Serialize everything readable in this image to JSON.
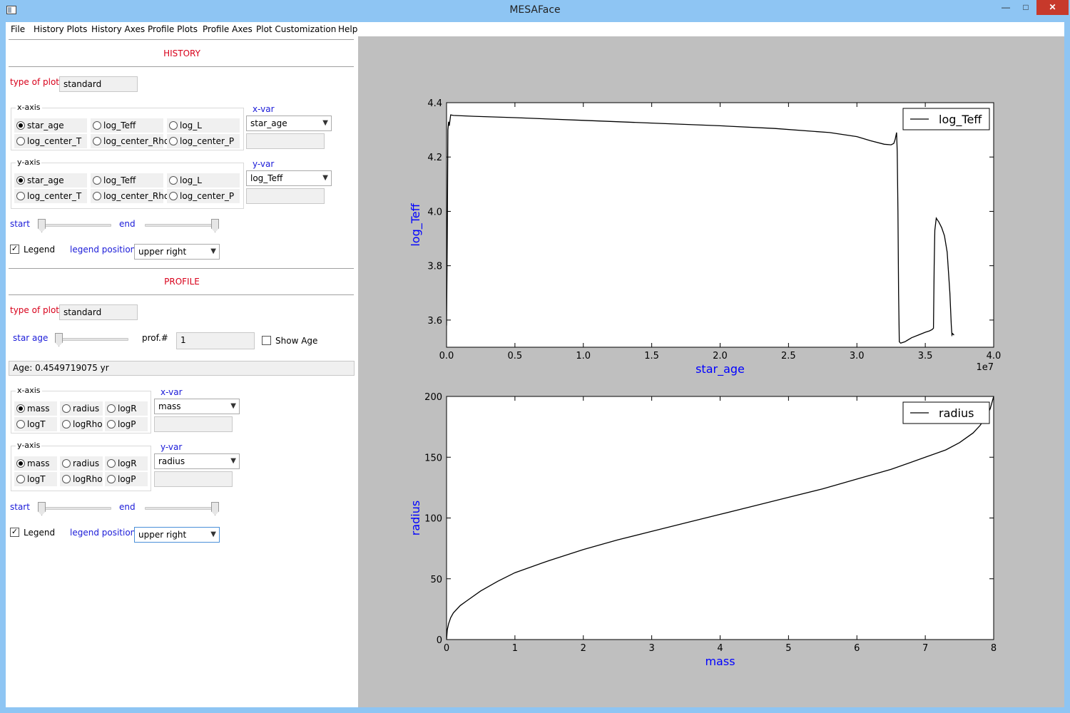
{
  "window": {
    "title": "MESAFace"
  },
  "menu": [
    "File",
    "History Plots",
    "History Axes",
    "Profile Plots",
    "Profile Axes",
    "Plot Customization",
    "Help"
  ],
  "history": {
    "section_title": "HISTORY",
    "type_of_plot_label": "type of plot:",
    "type_of_plot_value": "standard",
    "x_axis": {
      "group_title": "x-axis",
      "options": [
        "star_age",
        "log_Teff",
        "log_L",
        "log_center_T",
        "log_center_Rho",
        "log_center_P"
      ],
      "selected": "star_age",
      "var_label": "x-var",
      "var_value": "star_age",
      "var_text": ""
    },
    "y_axis": {
      "group_title": "y-axis",
      "options": [
        "star_age",
        "log_Teff",
        "log_L",
        "log_center_T",
        "log_center_Rho",
        "log_center_P"
      ],
      "selected": "star_age",
      "var_label": "y-var",
      "var_value": "log_Teff",
      "var_text": ""
    },
    "start_label": "start",
    "end_label": "end",
    "start_value": 0,
    "end_value": 1,
    "legend_label": "Legend",
    "legend_checked": true,
    "legend_position_label": "legend position",
    "legend_position_value": "upper right"
  },
  "profile": {
    "section_title": "PROFILE",
    "type_of_plot_label": "type of plot:",
    "type_of_plot_value": "standard",
    "star_age_label": "star age",
    "star_age_slider_value": 0,
    "prof_label": "prof.#",
    "prof_value": "1",
    "show_age_label": "Show Age",
    "show_age_checked": false,
    "age_text": "Age: 0.4549719075  yr",
    "x_axis": {
      "group_title": "x-axis",
      "options": [
        "mass",
        "radius",
        "logR",
        "logT",
        "logRho",
        "logP"
      ],
      "selected": "mass",
      "var_label": "x-var",
      "var_value": "mass",
      "var_text": ""
    },
    "y_axis": {
      "group_title": "y-axis",
      "options": [
        "mass",
        "radius",
        "logR",
        "logT",
        "logRho",
        "logP"
      ],
      "selected": "mass",
      "var_label": "y-var",
      "var_value": "radius",
      "var_text": ""
    },
    "start_label": "start",
    "end_label": "end",
    "start_value": 0,
    "end_value": 1,
    "legend_label": "Legend",
    "legend_checked": true,
    "legend_position_label": "legend position",
    "legend_position_value": "upper right"
  },
  "chart_data": [
    {
      "type": "line",
      "xlabel": "star_age",
      "ylabel": "log_Teff",
      "x_scale_label": "1e7",
      "xlim": [
        0.0,
        4.0
      ],
      "ylim": [
        3.5,
        4.4
      ],
      "x_ticks": [
        "0.0",
        "0.5",
        "1.0",
        "1.5",
        "2.0",
        "2.5",
        "3.0",
        "3.5",
        "4.0"
      ],
      "y_ticks": [
        "3.6",
        "3.8",
        "4.0",
        "4.2",
        "4.4"
      ],
      "legend_position": "upper right",
      "series": [
        {
          "name": "log_Teff",
          "x": [
            0.0,
            0.005,
            0.01,
            0.015,
            0.02,
            0.03,
            0.05,
            0.2,
            0.5,
            1.0,
            1.5,
            2.0,
            2.4,
            2.8,
            3.0,
            3.1,
            3.2,
            3.25,
            3.27,
            3.28,
            3.29,
            3.295,
            3.3,
            3.305,
            3.31,
            3.32,
            3.35,
            3.4,
            3.45,
            3.5,
            3.53,
            3.55,
            3.56,
            3.565,
            3.57,
            3.58,
            3.6,
            3.62,
            3.64,
            3.66,
            3.68,
            3.69,
            3.695,
            3.7,
            3.71
          ],
          "y": [
            3.58,
            3.9,
            4.3,
            4.33,
            4.315,
            4.355,
            4.353,
            4.35,
            4.345,
            4.335,
            4.325,
            4.315,
            4.305,
            4.29,
            4.275,
            4.26,
            4.247,
            4.245,
            4.25,
            4.265,
            4.29,
            4.22,
            4.0,
            3.7,
            3.52,
            3.515,
            3.52,
            3.535,
            3.545,
            3.555,
            3.56,
            3.565,
            3.57,
            3.8,
            3.93,
            3.975,
            3.96,
            3.94,
            3.91,
            3.85,
            3.7,
            3.58,
            3.545,
            3.55,
            3.545
          ]
        }
      ]
    },
    {
      "type": "line",
      "xlabel": "mass",
      "ylabel": "radius",
      "xlim": [
        0,
        8
      ],
      "ylim": [
        0,
        200
      ],
      "x_ticks": [
        "0",
        "1",
        "2",
        "3",
        "4",
        "5",
        "6",
        "7",
        "8"
      ],
      "y_ticks": [
        "0",
        "50",
        "100",
        "150",
        "200"
      ],
      "legend_position": "upper right",
      "series": [
        {
          "name": "radius",
          "x": [
            0.0,
            0.01,
            0.03,
            0.06,
            0.1,
            0.2,
            0.3,
            0.5,
            0.75,
            1.0,
            1.5,
            2.0,
            2.5,
            3.0,
            3.5,
            4.0,
            4.5,
            5.0,
            5.5,
            6.0,
            6.5,
            7.0,
            7.3,
            7.5,
            7.7,
            7.8,
            7.9,
            7.95,
            8.0
          ],
          "y": [
            0,
            8,
            13,
            18,
            22,
            28,
            32,
            40,
            48,
            55,
            65,
            74,
            82,
            89,
            96,
            103,
            110,
            117,
            124,
            132,
            140,
            150,
            156,
            162,
            170,
            176,
            184,
            190,
            200
          ]
        }
      ]
    }
  ]
}
